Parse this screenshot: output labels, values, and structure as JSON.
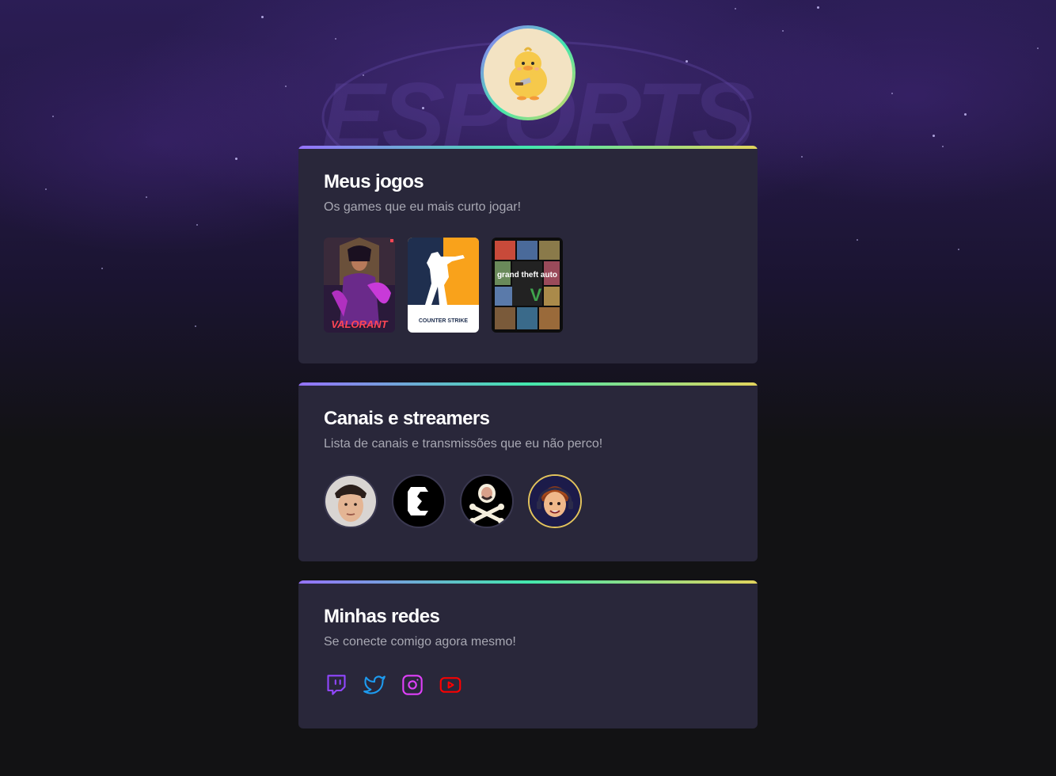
{
  "profile": {
    "avatar_icon": "duck-avatar-icon"
  },
  "background": {
    "watermark_text": "ESPORTS"
  },
  "games_section": {
    "title": "Meus jogos",
    "subtitle": "Os games que eu mais curto jogar!",
    "games": [
      {
        "name": "VALORANT",
        "accent": "#ff4655"
      },
      {
        "name": "COUNTER STRIKE",
        "accent": "#f9a21b"
      },
      {
        "name": "grand theft auto",
        "accent": "#3fa34d"
      }
    ]
  },
  "channels_section": {
    "title": "Canais e streamers",
    "subtitle": "Lista de canais e transmissões que eu não perco!",
    "channels": [
      {
        "icon": "streamer-face-avatar"
      },
      {
        "icon": "c-logo-avatar"
      },
      {
        "icon": "skull-crossbones-avatar"
      },
      {
        "icon": "cartoon-streamer-avatar"
      }
    ]
  },
  "social_section": {
    "title": "Minhas redes",
    "subtitle": "Se conecte comigo agora mesmo!",
    "links": [
      {
        "icon": "twitch-icon",
        "color": "#9147ff"
      },
      {
        "icon": "twitter-icon",
        "color": "#1d9bf0"
      },
      {
        "icon": "instagram-icon",
        "color": "#e040fb"
      },
      {
        "icon": "youtube-icon",
        "color": "#ff0000"
      }
    ]
  },
  "colors": {
    "card_bg": "#29273a",
    "page_bg": "#121214",
    "gradient": [
      "#9572fc",
      "#43e7ad",
      "#e2d45c"
    ]
  }
}
